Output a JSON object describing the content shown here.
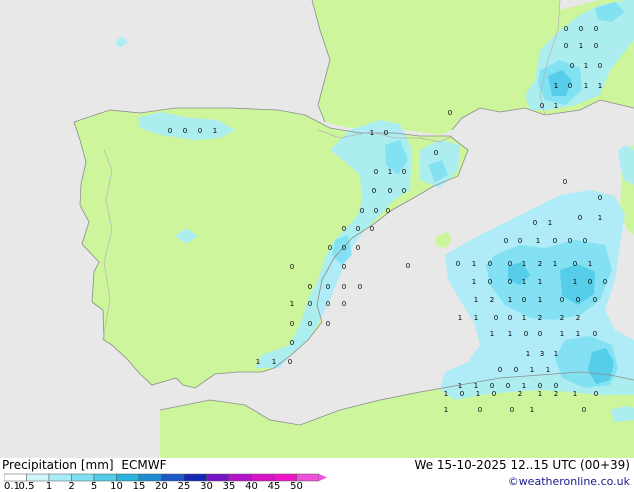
{
  "colors": {
    "sea": "#e8e8e8",
    "land": "#ccf59c",
    "border": "#b4b4b4",
    "coast": "#8c8c8c"
  },
  "legend": {
    "title": "Precipitation [mm]",
    "model": "ECMWF",
    "ticks": [
      "0.1",
      "0.5",
      "1",
      "2",
      "5",
      "10",
      "15",
      "20",
      "25",
      "30",
      "35",
      "40",
      "45",
      "50"
    ],
    "colors": [
      "#ffffff",
      "#d0f5fc",
      "#a8ecf8",
      "#7ee0f2",
      "#52cce8",
      "#28b4dc",
      "#1e8cd2",
      "#1e5ac8",
      "#1428b4",
      "#7814c8",
      "#b414c8",
      "#d814c8",
      "#f014c8",
      "#f050dc"
    ]
  },
  "valid_time": "We 15-10-2025 12..15 UTC (00+39)",
  "credit": "©weatheronline.co.uk",
  "point_values": [
    {
      "v": "0"
    },
    {
      "v": "0"
    },
    {
      "v": "0"
    },
    {
      "v": "1"
    },
    {
      "v": "1"
    },
    {
      "v": "0"
    },
    {
      "v": "0"
    },
    {
      "v": "0"
    },
    {
      "v": "1"
    },
    {
      "v": "0"
    },
    {
      "v": "0"
    },
    {
      "v": "0"
    },
    {
      "v": "0"
    },
    {
      "v": "0"
    },
    {
      "v": "0"
    },
    {
      "v": "0"
    },
    {
      "v": "0"
    },
    {
      "v": "0"
    },
    {
      "v": "0"
    },
    {
      "v": "0"
    },
    {
      "v": "0"
    },
    {
      "v": "0"
    },
    {
      "v": "0"
    },
    {
      "v": "0"
    },
    {
      "v": "0"
    },
    {
      "v": "0"
    },
    {
      "v": "0"
    },
    {
      "v": "0"
    },
    {
      "v": "1"
    },
    {
      "v": "0"
    },
    {
      "v": "0"
    },
    {
      "v": "0"
    },
    {
      "v": "0"
    },
    {
      "v": "0"
    },
    {
      "v": "0"
    },
    {
      "v": "0"
    },
    {
      "v": "1"
    },
    {
      "v": "1"
    },
    {
      "v": "0"
    },
    {
      "v": "0"
    },
    {
      "v": "0"
    },
    {
      "v": "0"
    },
    {
      "v": "0"
    },
    {
      "v": "1"
    },
    {
      "v": "0"
    },
    {
      "v": "0"
    },
    {
      "v": "1"
    },
    {
      "v": "0"
    },
    {
      "v": "1"
    },
    {
      "v": "0"
    },
    {
      "v": "1"
    },
    {
      "v": "1"
    },
    {
      "v": "0"
    },
    {
      "v": "1"
    },
    {
      "v": "0"
    },
    {
      "v": "0"
    },
    {
      "v": "0"
    },
    {
      "v": "0"
    },
    {
      "v": "0"
    },
    {
      "v": "1"
    },
    {
      "v": "0"
    },
    {
      "v": "1"
    },
    {
      "v": "0"
    },
    {
      "v": "0"
    },
    {
      "v": "1"
    },
    {
      "v": "0"
    },
    {
      "v": "0"
    },
    {
      "v": "0"
    },
    {
      "v": "0"
    },
    {
      "v": "1"
    },
    {
      "v": "0"
    },
    {
      "v": "0"
    },
    {
      "v": "1"
    },
    {
      "v": "2"
    },
    {
      "v": "1"
    },
    {
      "v": "0"
    },
    {
      "v": "1"
    },
    {
      "v": "1"
    },
    {
      "v": "0"
    },
    {
      "v": "0"
    },
    {
      "v": "1"
    },
    {
      "v": "1"
    },
    {
      "v": "1"
    },
    {
      "v": "0"
    },
    {
      "v": "0"
    },
    {
      "v": "1"
    },
    {
      "v": "2"
    },
    {
      "v": "1"
    },
    {
      "v": "0"
    },
    {
      "v": "1"
    },
    {
      "v": "0"
    },
    {
      "v": "0"
    },
    {
      "v": "0"
    },
    {
      "v": "1"
    },
    {
      "v": "1"
    },
    {
      "v": "0"
    },
    {
      "v": "0"
    },
    {
      "v": "1"
    },
    {
      "v": "2"
    },
    {
      "v": "2"
    },
    {
      "v": "2"
    },
    {
      "v": "1"
    },
    {
      "v": "1"
    },
    {
      "v": "0"
    },
    {
      "v": "0"
    },
    {
      "v": "1"
    },
    {
      "v": "1"
    },
    {
      "v": "0"
    },
    {
      "v": "1"
    },
    {
      "v": "3"
    },
    {
      "v": "1"
    },
    {
      "v": "0"
    },
    {
      "v": "0"
    },
    {
      "v": "1"
    },
    {
      "v": "1"
    },
    {
      "v": "1"
    },
    {
      "v": "1"
    },
    {
      "v": "0"
    },
    {
      "v": "0"
    },
    {
      "v": "1"
    },
    {
      "v": "0"
    },
    {
      "v": "0"
    },
    {
      "v": "1"
    },
    {
      "v": "0"
    },
    {
      "v": "1"
    },
    {
      "v": "0"
    },
    {
      "v": "2"
    },
    {
      "v": "1"
    },
    {
      "v": "2"
    },
    {
      "v": "1"
    },
    {
      "v": "0"
    },
    {
      "v": "1"
    },
    {
      "v": "0"
    },
    {
      "v": "0"
    },
    {
      "v": "1"
    },
    {
      "v": "0"
    },
    {
      "v": "1"
    },
    {
      "v": "1"
    },
    {
      "v": "0"
    },
    {
      "v": "0"
    },
    {
      "v": "3"
    },
    {
      "v": "0"
    },
    {
      "v": "0"
    },
    {
      "v": "0"
    },
    {
      "v": "0"
    },
    {
      "v": "0"
    }
  ]
}
